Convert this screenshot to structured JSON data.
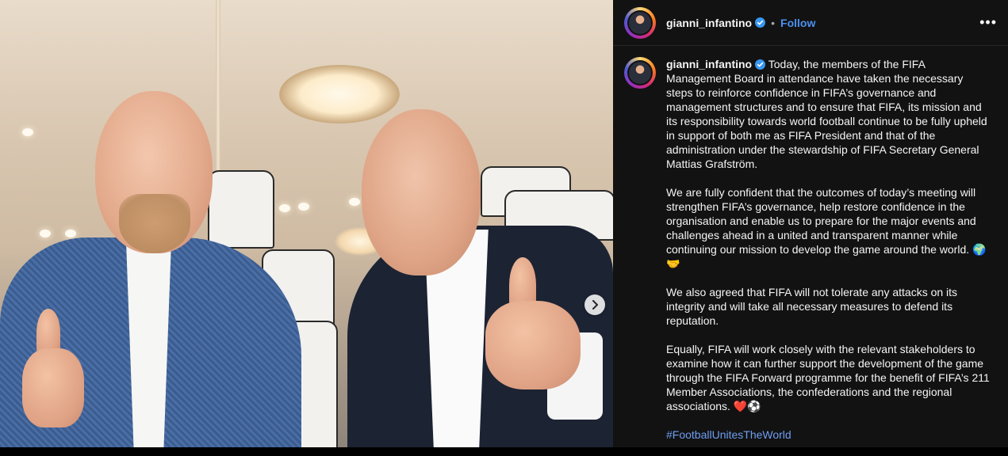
{
  "post": {
    "username": "gianni_infantino",
    "follow_label": "Follow",
    "separator": "•",
    "more_label": "•••",
    "caption_first": "Today, the members of the FIFA Management Board in attendance have taken the necessary steps to reinforce confidence in FIFA’s governance and management structures and to ensure that FIFA, its mission and its responsibility towards world football continue to be fully upheld in support of both me as FIFA President and that of the administration under the stewardship of FIFA Secretary General Mattias Grafström.",
    "paragraph_2": "We are fully confident that the outcomes of today’s meeting will strengthen FIFA’s governance, help restore confidence in the organisation and enable us to prepare for the major events and challenges ahead in a united and transparent manner while continuing our mission to develop the game around the world. 🌍🤝",
    "paragraph_3": "We also agreed that FIFA will not tolerate any attacks on its integrity and will take all necessary measures to defend its reputation.",
    "paragraph_4": "Equally, FIFA will work closely with the relevant stakeholders to examine how it can further support the development of the game through the FIFA Forward programme for the benefit of FIFA’s 211 Member Associations, the confederations and the regional associations. ❤️⚽",
    "hashtag": "#FootballUnitesTheWorld"
  },
  "icons": {
    "verified": "verified-badge-icon",
    "next": "chevron-right-icon",
    "more": "more-options-icon"
  },
  "colors": {
    "panel_bg": "#121212",
    "follow": "#4a91f1",
    "hashtag": "#6f9ef2",
    "verified": "#3897f0"
  }
}
